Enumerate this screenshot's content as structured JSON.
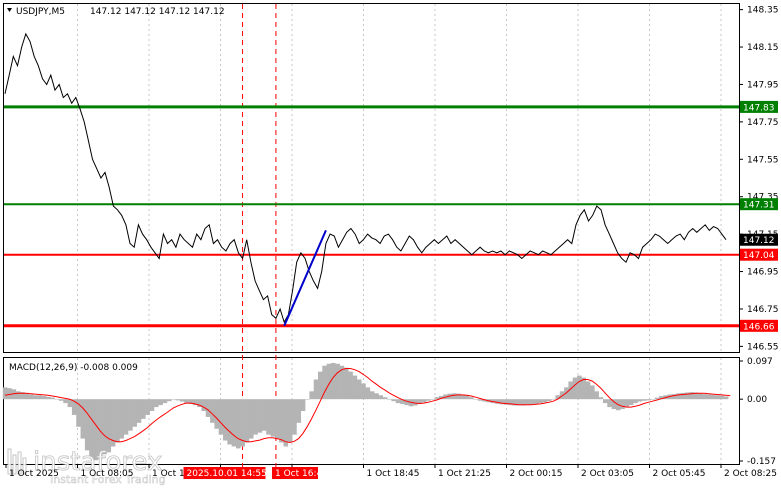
{
  "header": {
    "symbol": "USDJPY,M5",
    "ohlc": "147.12 147.12 147.12 147.12"
  },
  "macd": {
    "label": "MACD(12,26,9) -0.008 0.009",
    "ticks": [
      "0.097",
      "0.00",
      "-0.157"
    ]
  },
  "watermark": {
    "brand": "instaforex",
    "tagline": "Instant Forex Trading"
  },
  "time_labels": [
    "1 Oct 2025",
    "1 Oct 08:05",
    "1 Oct 10:45",
    "2025.10.01 14:55",
    "1 Oct 16:45",
    "1 Oct 18:45",
    "1 Oct 21:25",
    "2 Oct 00:15",
    "2 Oct 03:05",
    "2 Oct 05:45",
    "2 Oct 08:25"
  ],
  "colors": {
    "green_level": "#008000",
    "red_level": "#ff0000",
    "price_line": "#000000",
    "trend_line": "#0000cc",
    "histogram": "#b4b4b4",
    "signal": "#ff0000",
    "current_price": "#000000"
  },
  "chart_data": {
    "type": "line",
    "symbol": "USDJPY",
    "timeframe": "M5",
    "y_ticks": [
      "148.35",
      "148.15",
      "147.95",
      "147.75",
      "147.55",
      "147.35",
      "147.15",
      "146.95",
      "146.75",
      "146.55"
    ],
    "ylim": [
      146.52,
      148.38
    ],
    "levels": [
      {
        "label": "147.83",
        "value": 147.83,
        "color": "#008000"
      },
      {
        "label": "147.31",
        "value": 147.31,
        "color": "#008000"
      },
      {
        "label": "147.04",
        "value": 147.04,
        "color": "#ff0000"
      },
      {
        "label": "146.66",
        "value": 146.66,
        "color": "#ff0000"
      }
    ],
    "current_price": {
      "label": "147.12",
      "value": 147.12
    },
    "series": [
      {
        "values": [
          147.9,
          148.0,
          148.1,
          148.05,
          148.15,
          148.22,
          148.18,
          148.1,
          148.05,
          147.98,
          147.95,
          148.0,
          147.92,
          147.95,
          147.88,
          147.9,
          147.85,
          147.88,
          147.82,
          147.75,
          147.65,
          147.55,
          147.5,
          147.45,
          147.48,
          147.4,
          147.3,
          147.28,
          147.25,
          147.2,
          147.1,
          147.08,
          147.2,
          147.15,
          147.12,
          147.08,
          147.05,
          147.02,
          147.15,
          147.1,
          147.12,
          147.08,
          147.15,
          147.12,
          147.1,
          147.08,
          147.15,
          147.12,
          147.18,
          147.2,
          147.1,
          147.12,
          147.08,
          147.06,
          147.1,
          147.12,
          147.05,
          147.02,
          147.12,
          147.0,
          146.9,
          146.85,
          146.8,
          146.82,
          146.72,
          146.7,
          146.75,
          146.68,
          146.72,
          146.85,
          147.0,
          147.05,
          147.02,
          146.95,
          146.9,
          146.86,
          146.95,
          147.1,
          147.15,
          147.14,
          147.08,
          147.12,
          147.16,
          147.18,
          147.15,
          147.1,
          147.12,
          147.15,
          147.13,
          147.12,
          147.1,
          147.14,
          147.15,
          147.12,
          147.08,
          147.06,
          147.1,
          147.14,
          147.12,
          147.08,
          147.05,
          147.08,
          147.1,
          147.12,
          147.1,
          147.12,
          147.14,
          147.1,
          147.12,
          147.1,
          147.08,
          147.06,
          147.04,
          147.06,
          147.08,
          147.06,
          147.05,
          147.06,
          147.05,
          147.06,
          147.04,
          147.06,
          147.05,
          147.04,
          147.02,
          147.04,
          147.06,
          147.05,
          147.04,
          147.06,
          147.05,
          147.04,
          147.06,
          147.08,
          147.1,
          147.12,
          147.1,
          147.2,
          147.25,
          147.28,
          147.22,
          147.25,
          147.3,
          147.28,
          147.2,
          147.15,
          147.1,
          147.05,
          147.02,
          147.0,
          147.05,
          147.04,
          147.02,
          147.08,
          147.1,
          147.12,
          147.15,
          147.14,
          147.12,
          147.1,
          147.12,
          147.14,
          147.15,
          147.12,
          147.16,
          147.18,
          147.16,
          147.18,
          147.2,
          147.17,
          147.19,
          147.18,
          147.15,
          147.12
        ]
      }
    ],
    "trend_line": {
      "from": {
        "index": 67,
        "value": 146.66
      },
      "to": {
        "index": 77,
        "value": 147.17
      }
    },
    "vlines_at": [
      57,
      65
    ],
    "macd": {
      "ylim": [
        -0.157,
        0.097
      ],
      "histogram": [
        0.03,
        0.028,
        0.025,
        0.02,
        0.018,
        0.015,
        0.012,
        0.01,
        0.01,
        0.008,
        0.006,
        0.004,
        0.0,
        -0.004,
        -0.01,
        -0.02,
        -0.04,
        -0.07,
        -0.1,
        -0.13,
        -0.15,
        -0.155,
        -0.152,
        -0.14,
        -0.135,
        -0.12,
        -0.11,
        -0.1,
        -0.09,
        -0.08,
        -0.07,
        -0.06,
        -0.05,
        -0.04,
        -0.03,
        -0.02,
        -0.015,
        -0.01,
        -0.005,
        0.0,
        -0.003,
        -0.006,
        -0.01,
        -0.012,
        -0.015,
        -0.02,
        -0.03,
        -0.045,
        -0.06,
        -0.075,
        -0.09,
        -0.105,
        -0.115,
        -0.12,
        -0.125,
        -0.12,
        -0.11,
        -0.1,
        -0.09,
        -0.085,
        -0.08,
        -0.09,
        -0.095,
        -0.1,
        -0.11,
        -0.12,
        -0.11,
        -0.09,
        -0.06,
        -0.03,
        0.0,
        0.02,
        0.05,
        0.07,
        0.085,
        0.09,
        0.092,
        0.09,
        0.085,
        0.08,
        0.07,
        0.06,
        0.05,
        0.04,
        0.03,
        0.02,
        0.015,
        0.01,
        0.005,
        0.0,
        -0.005,
        -0.01,
        -0.012,
        -0.015,
        -0.018,
        -0.016,
        -0.012,
        -0.008,
        -0.004,
        0.0,
        0.005,
        0.008,
        0.012,
        0.014,
        0.015,
        0.014,
        0.012,
        0.01,
        0.005,
        0.0,
        -0.004,
        -0.006,
        -0.008,
        -0.01,
        -0.012,
        -0.013,
        -0.014,
        -0.015,
        -0.016,
        -0.016,
        -0.016,
        -0.015,
        -0.014,
        -0.012,
        -0.01,
        -0.008,
        -0.005,
        0.0,
        0.01,
        0.02,
        0.03,
        0.045,
        0.055,
        0.06,
        0.055,
        0.045,
        0.035,
        0.02,
        0.005,
        -0.01,
        -0.02,
        -0.025,
        -0.028,
        -0.025,
        -0.02,
        -0.015,
        -0.01,
        -0.006,
        -0.004,
        -0.003,
        0.0,
        0.004,
        0.008,
        0.01,
        0.012,
        0.013,
        0.015,
        0.016,
        0.017,
        0.018,
        0.017,
        0.015,
        0.013,
        0.012,
        0.011,
        0.01,
        0.009,
        0.007
      ],
      "signal": [
        0.01,
        0.012,
        0.014,
        0.015,
        0.015,
        0.015,
        0.014,
        0.013,
        0.012,
        0.011,
        0.01,
        0.008,
        0.006,
        0.004,
        0.002,
        0.0,
        -0.005,
        -0.012,
        -0.022,
        -0.035,
        -0.05,
        -0.065,
        -0.08,
        -0.092,
        -0.1,
        -0.105,
        -0.108,
        -0.108,
        -0.105,
        -0.1,
        -0.095,
        -0.088,
        -0.08,
        -0.072,
        -0.062,
        -0.053,
        -0.045,
        -0.038,
        -0.03,
        -0.022,
        -0.017,
        -0.013,
        -0.01,
        -0.01,
        -0.012,
        -0.015,
        -0.02,
        -0.027,
        -0.037,
        -0.048,
        -0.06,
        -0.072,
        -0.082,
        -0.092,
        -0.1,
        -0.105,
        -0.108,
        -0.108,
        -0.106,
        -0.104,
        -0.1,
        -0.098,
        -0.098,
        -0.1,
        -0.103,
        -0.108,
        -0.11,
        -0.107,
        -0.1,
        -0.087,
        -0.07,
        -0.05,
        -0.028,
        -0.005,
        0.018,
        0.038,
        0.055,
        0.067,
        0.075,
        0.078,
        0.078,
        0.075,
        0.07,
        0.063,
        0.055,
        0.046,
        0.038,
        0.03,
        0.023,
        0.016,
        0.01,
        0.004,
        -0.001,
        -0.005,
        -0.008,
        -0.01,
        -0.011,
        -0.01,
        -0.008,
        -0.005,
        -0.002,
        0.002,
        0.005,
        0.008,
        0.01,
        0.011,
        0.011,
        0.01,
        0.008,
        0.005,
        0.002,
        -0.001,
        -0.004,
        -0.006,
        -0.008,
        -0.01,
        -0.011,
        -0.012,
        -0.013,
        -0.014,
        -0.014,
        -0.014,
        -0.014,
        -0.013,
        -0.012,
        -0.01,
        -0.008,
        -0.005,
        0.0,
        0.008,
        0.016,
        0.026,
        0.036,
        0.045,
        0.05,
        0.05,
        0.046,
        0.038,
        0.028,
        0.016,
        0.004,
        -0.006,
        -0.014,
        -0.018,
        -0.02,
        -0.02,
        -0.018,
        -0.015,
        -0.011,
        -0.008,
        -0.005,
        -0.002,
        0.001,
        0.004,
        0.007,
        0.009,
        0.011,
        0.012,
        0.013,
        0.014,
        0.015,
        0.015,
        0.015,
        0.014,
        0.013,
        0.012,
        0.011,
        0.01,
        0.009
      ]
    }
  }
}
